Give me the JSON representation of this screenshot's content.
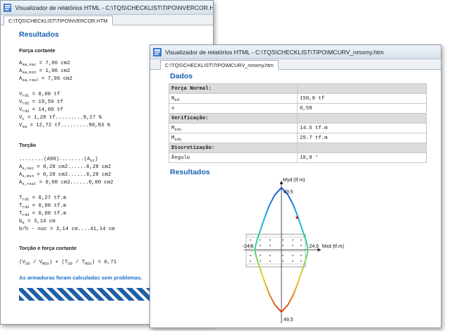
{
  "colors": {
    "heading": "#1a5fb4",
    "message": "#1a6ec8",
    "stripes": "#1f5fa8",
    "curve_top": "#1e3cdc",
    "curve_bottom": "#e01818"
  },
  "window_back": {
    "title": "Visualizador de relatórios HTML - C:\\TQS\\CHECKLIST\\TIPO\\NVERCOR.HTM",
    "tab": "C:\\TQS\\CHECKLIST\\TIPO\\NVERCOR.HTM",
    "heading": "Resultados",
    "sec_shear": "Força cortante",
    "asw_nec": {
      "sym": "A",
      "sub": "sw,nec",
      "rest": " = 7,06 cm2"
    },
    "asw_min": {
      "sym": "A",
      "sub": "sw,min",
      "rest": " = 1,06 cm2"
    },
    "asw_real": {
      "sym": "A",
      "sub": "sw,real",
      "rest": " = 7,06 cm2"
    },
    "vrd1": {
      "sym": "V",
      "sub": "rd1",
      "rest": " = 0,00 tf"
    },
    "vrd2": {
      "sym": "V",
      "sub": "rd2",
      "rest": " = 19,59 tf"
    },
    "vrd3": {
      "sym": "V",
      "sub": "rd3",
      "rest": " = 14,00 tf"
    },
    "vc": {
      "sym": "V",
      "sub": "c",
      "rest": " = 1,28 tf.........9,17 %"
    },
    "vsw": {
      "sym": "V",
      "sub": "sw",
      "rest": " = 12,72 tf.........90,83 %"
    },
    "sec_torsion": "Torção",
    "torsion_header": {
      "pre": "........(A90)........(A",
      "sub": "s1",
      "post": ")"
    },
    "as_nec": {
      "sym": "A",
      "sub": "s,nec",
      "rest": " = 0,28 cm2......0,28 cm2"
    },
    "as_min": {
      "sym": "A",
      "sub": "s,min",
      "rest": " = 0,28 cm2......0,28 cm2"
    },
    "as_real": {
      "sym": "A",
      "sub": "s,real",
      "rest": " = 0,00 cm2......0,00 cm2"
    },
    "trd2": {
      "sym": "T",
      "sub": "rd2",
      "rest": " = 0,27 tf.m"
    },
    "trd3": {
      "sym": "T",
      "sub": "rd3",
      "rest": " = 0,00 tf.m"
    },
    "trd4": {
      "sym": "T",
      "sub": "rd4",
      "rest": " = 0,00 tf.m"
    },
    "be": {
      "sym": "b",
      "sub": "e",
      "rest": " = 3,14 cm"
    },
    "bh_line": "b/h - nuc = 3,14 cm....41,14 cm",
    "sec_combined": "Torção e força cortante",
    "combo": {
      "p1": "(V",
      "s1": "SD",
      "p2": " / V",
      "s2": "RD2",
      "p3": ") + (T",
      "s3": "SD",
      "p4": " / T",
      "s4": "RD2",
      "p5": ") = 0,71"
    },
    "message": "As armaduras foram calculadas sem problemas."
  },
  "window_front": {
    "title": "Visualizador de relatórios HTML - C:\\TQS\\CHECKLIST\\TIPO\\MCURV_nmxmy.htm",
    "tab": "C:\\TQS\\CHECKLIST\\TIPO\\MCURV_nmxmy.htm",
    "heading_data": "Dados",
    "table": {
      "sec_normal": "Força Normal:",
      "nsd_sym": "N",
      "nsd_sub": "sd",
      "nsd_val": "150,0 tf",
      "nu_sym": "ν",
      "nu_val": "0,58",
      "sec_verif": "Verificação:",
      "msdx_sym": "M",
      "msdx_sub": "sdx",
      "msdx_val": "14.5 tf.m",
      "msdy_sym": "M",
      "msdy_sub": "sdy",
      "msdy_val": "25.7 tf.m",
      "sec_discr": "Discretização:",
      "angle_label": "Ângulo",
      "angle_val": "10,0 °"
    },
    "heading_results": "Resultados"
  },
  "chart_data": {
    "type": "line",
    "xlabel": "Mxd (tf.m)",
    "ylabel": "Myd (tf.m)",
    "x_range": [
      -24.6,
      24.6
    ],
    "y_range": [
      -49.5,
      49.5
    ],
    "tick_labels": {
      "x_min": "-24,6",
      "x_max": "24,6",
      "y_max": "49,5",
      "y_min": "49,5"
    },
    "series": [
      {
        "values_x": [
          0,
          6,
          11,
          15.5,
          19.5,
          22.6,
          24.2,
          24.6,
          24.2,
          22.6,
          19.5,
          15.5,
          11,
          6,
          0,
          -6,
          -11,
          -15.5,
          -19.5,
          -22.6,
          -24.2,
          -24.6,
          -24.2,
          -22.6,
          -19.5,
          -15.5,
          -11,
          -6,
          0
        ],
        "values_y": [
          49.5,
          44,
          36,
          26,
          16,
          8,
          3,
          0,
          -3,
          -8,
          -16,
          -26,
          -36,
          -44,
          -49.5,
          -44,
          -36,
          -26,
          -16,
          -8,
          -3,
          0,
          3,
          8,
          16,
          26,
          36,
          44,
          49.5
        ]
      }
    ],
    "design_point": {
      "x": 14.5,
      "y": 25.7
    },
    "grid": false
  }
}
